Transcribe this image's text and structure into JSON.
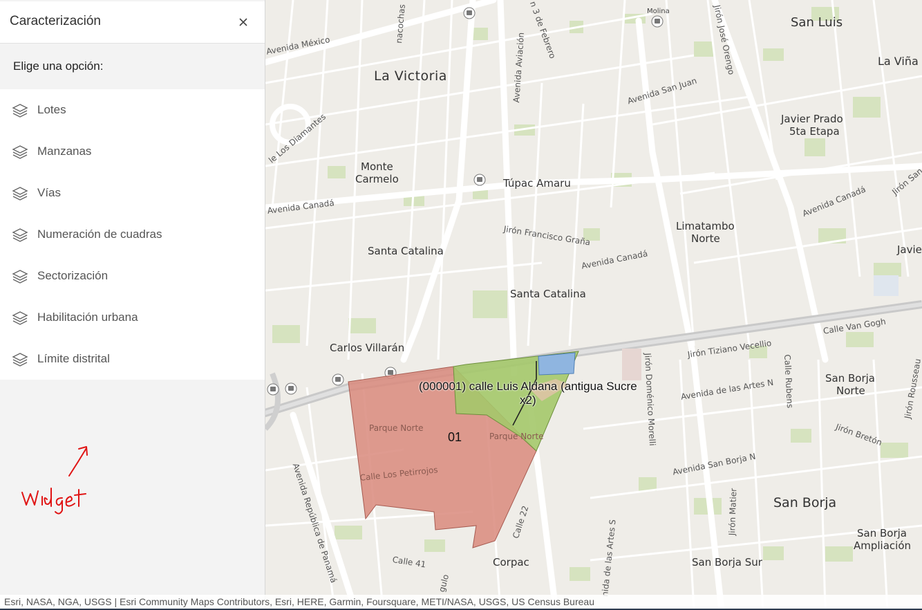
{
  "panel": {
    "title": "Caracterización",
    "prompt": "Elige una opción:",
    "options": [
      {
        "label": "Lotes",
        "icon": "layers-icon"
      },
      {
        "label": "Manzanas",
        "icon": "layers-icon"
      },
      {
        "label": "Vías",
        "icon": "layers-icon"
      },
      {
        "label": "Numeración de cuadras",
        "icon": "layers-icon"
      },
      {
        "label": "Sectorización",
        "icon": "layers-icon"
      },
      {
        "label": "Habilitación urbana",
        "icon": "layers-icon"
      },
      {
        "label": "Límite distrital",
        "icon": "layers-icon"
      }
    ],
    "annotation": "widget"
  },
  "map": {
    "places": {
      "la_victoria": "La Victoria",
      "san_luis": "San Luis",
      "la_vina": "La Viña",
      "javier_prado_1": "Javier Prado",
      "javier_prado_2": "5ta Etapa",
      "monte_carmelo_1": "Monte",
      "monte_carmelo_2": "Carmelo",
      "tupac_amaru": "Túpac Amaru",
      "limatambo_1": "Limatambo",
      "limatambo_2": "Norte",
      "santa_catalina_w": "Santa Catalina",
      "santa_catalina_c": "Santa Catalina",
      "javie": "Javie",
      "carlos_villaran": "Carlos Villarán",
      "san_borja_norte_1": "San Borja",
      "san_borja_norte_2": "Norte",
      "san_borja": "San Borja",
      "san_borja_ampl_1": "San Borja",
      "san_borja_ampl_2": "Ampliación",
      "san_borja_sur": "San Borja Sur",
      "corpac": "Corpac",
      "molina": "Molina"
    },
    "streets": {
      "av_mexico": "Avenida México",
      "nacochas": "nacochas",
      "av_aviacion": "Avenida Aviación",
      "febrero": "n 3 de Febrero",
      "jr_jose_orengo": "Jirón José Orengo",
      "av_san_juan": "Avenida San Juan",
      "los_diamantes": "le Los Diamantes",
      "av_canada_w": "Avenida Canadá",
      "av_canada_c": "Avenida Canadá",
      "av_canada_e": "Avenida Canadá",
      "jr_san": "Jirón San",
      "jr_francisco_grana": "Jirón Francisco Graña",
      "calle_van_gogh": "Calle Van Gogh",
      "jr_tiziano": "Jirón Tiziano Vecellio",
      "av_artes_n": "Avenida de las Artes N",
      "calle_rubens": "Calle Rubens",
      "jr_domenico": "Jirón Doménico Morelli",
      "jr_rousseau": "Jirón Rousseau",
      "jr_breton": "Jirón Bretón",
      "av_san_borja_n": "Avenida San Borja N",
      "av_rep_panama": "Avenida República de Panamá",
      "calle_22": "Calle 22",
      "av_artes_s": "nida de las Artes S",
      "jr_matier": "Jirón Matier",
      "calle_41": "Calle 41",
      "gulo": "gulo",
      "parque_norte_1": "Parque Norte",
      "parque_norte_2": "Parque Norte",
      "calle_petirrojos": "Calle Los Petirrojos"
    },
    "feature_label": "(000001) calle Luis Aldana (antigua Sucre",
    "feature_label_2": "x2)",
    "sector_label": "01",
    "colors": {
      "sector_fill": "#d98a7c",
      "parcel_fill": "#a4c86a",
      "block_fill": "#8fb5e0"
    }
  },
  "attribution": "Esri, NASA, NGA, USGS | Esri Community Maps Contributors, Esri, HERE, Garmin, Foursquare, METI/NASA, USGS, US Census Bureau"
}
